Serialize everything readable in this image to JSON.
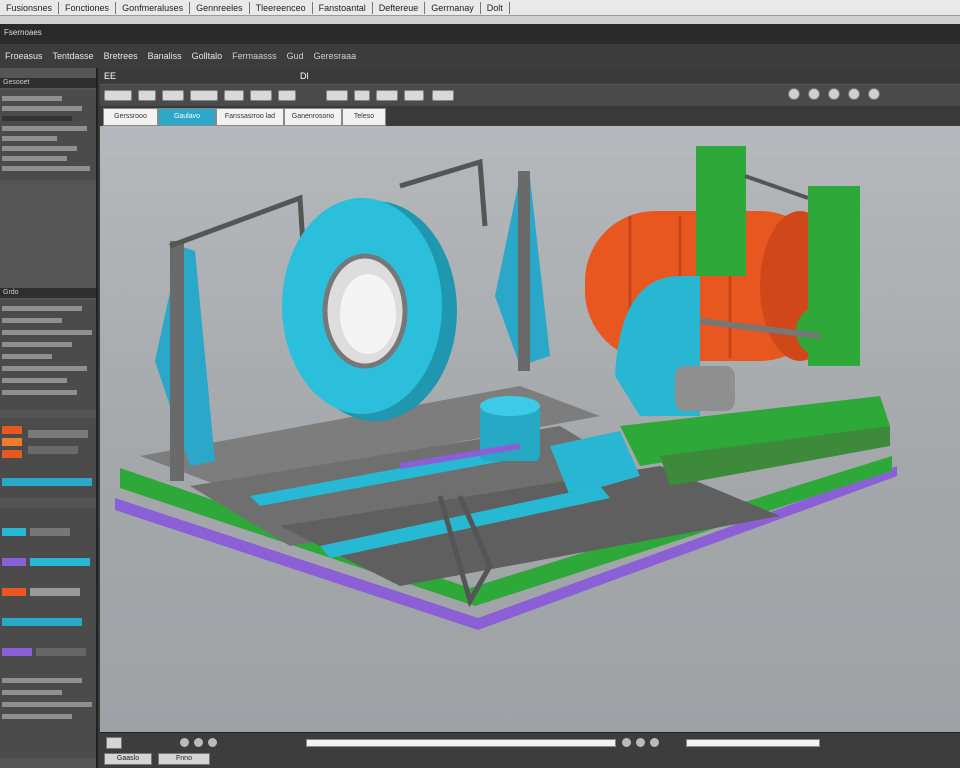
{
  "menu": {
    "items": [
      "Fusionsnes",
      "Fonctiones",
      "Gonfmeraluses",
      "Gennreeles",
      "Tleereenceo",
      "Fanstoantal",
      "Deftereue",
      "Gerrnanay",
      "Dolt"
    ]
  },
  "title": "Fsernoaes",
  "ribbon": {
    "tabs": [
      "Froeasus",
      "Tentdasse",
      "Bretrees",
      "Banaliss",
      "Golltalo"
    ],
    "subtabs": [
      "Fermaasss",
      "Gud",
      "Geresraaa"
    ]
  },
  "toolbar": {
    "label_a": "EE",
    "label_b": "Dl"
  },
  "viewport_tabs": [
    "Gerssrooo",
    "Gaulavo",
    "Fanssasrroo lad",
    "Ganenrosono",
    "Teleso"
  ],
  "left_panel": {
    "header_1": "Gesooet",
    "header_2": "Grdo"
  },
  "status": {
    "btn_1": "Gaaslo",
    "btn_2": "Fnno"
  },
  "colors": {
    "accent": "#2aa7c9",
    "model_cyan": "#27b9d4",
    "model_orange": "#e8571f",
    "model_green": "#2fa83a",
    "model_purple": "#8b5fd6"
  }
}
